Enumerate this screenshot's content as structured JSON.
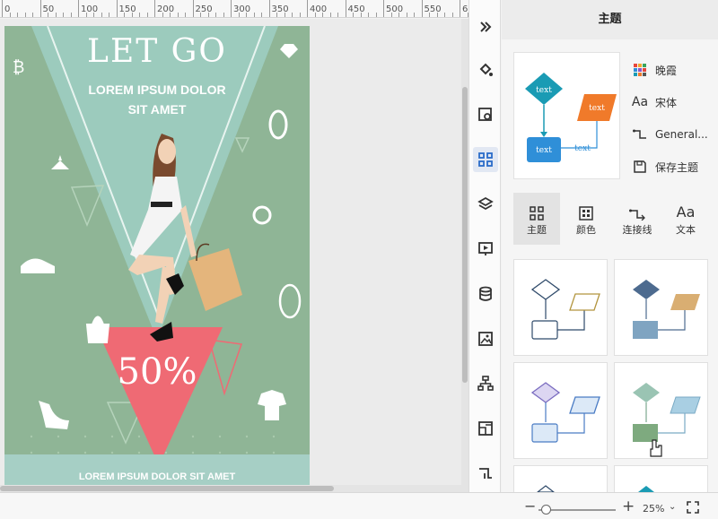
{
  "ruler": {
    "labels": [
      "0",
      "50",
      "100",
      "150",
      "200",
      "250",
      "300",
      "350",
      "400",
      "450",
      "500",
      "550",
      "6"
    ]
  },
  "poster": {
    "headline": "LET GO",
    "subline": "LOREM IPSUM DOLOR SIT AMET",
    "discount": "50%",
    "footer": "LOREM IPSUM DOLOR SIT AMET",
    "colors": {
      "background": "#8fb596",
      "triangle": "#9ccbbd",
      "sale_triangle": "#ef6a74",
      "bag": "#e4b57c"
    },
    "icons": [
      "currency-icon",
      "diamond-icon",
      "ring-icon",
      "lamp-icon",
      "shoe-icon",
      "handbag-icon",
      "gem-icon",
      "heel-icon",
      "tshirt-icon"
    ]
  },
  "iconbar": {
    "items": [
      {
        "name": "collapse-icon"
      },
      {
        "name": "fill-icon"
      },
      {
        "name": "image-edit-icon"
      },
      {
        "name": "theme-grid-icon",
        "active": true
      },
      {
        "name": "layers-icon"
      },
      {
        "name": "presentation-icon"
      },
      {
        "name": "database-icon"
      },
      {
        "name": "picture-icon"
      },
      {
        "name": "org-chart-icon"
      },
      {
        "name": "page-layout-icon"
      },
      {
        "name": "connector-icon"
      }
    ]
  },
  "panel": {
    "title": "主题",
    "preview": {
      "node_label": "text",
      "connector_label": "text",
      "colors": {
        "diamond": "#1a9bb4",
        "box": "#2f8fd8",
        "parallelogram": "#f07a2a"
      }
    },
    "props": [
      {
        "icon": "color-scheme-icon",
        "label": "晚霞"
      },
      {
        "icon": "font-icon",
        "label": "宋体",
        "icon_text": "Aa"
      },
      {
        "icon": "connector-style-icon",
        "label": "General..."
      },
      {
        "icon": "save-icon",
        "label": "保存主题"
      }
    ],
    "tabs": [
      {
        "label": "主题",
        "icon": "theme-grid-icon",
        "active": true
      },
      {
        "label": "颜色",
        "icon": "palette-icon"
      },
      {
        "label": "连接线",
        "icon": "connector-icon"
      },
      {
        "label": "文本",
        "icon": "text-icon",
        "icon_text": "Aa"
      }
    ],
    "themes": [
      {
        "fill_diamond": "#ffffff",
        "stroke": "#2f4a6a",
        "fill_box": "#ffffff",
        "fill_para": "#ffffff",
        "stroke_para": "#b2953e"
      },
      {
        "fill_diamond": "#4d6b8f",
        "stroke": "#4d6b8f",
        "fill_box": "#7fa4c1",
        "fill_para": "#d9ae72",
        "stroke_para": "#d9ae72"
      },
      {
        "fill_diamond": "#dcd6f2",
        "stroke": "#7a6cc0",
        "fill_box": "#dce9f7",
        "fill_para": "#dce9f7",
        "stroke_para": "#4a7cc4"
      },
      {
        "fill_diamond": "#9ac4b3",
        "stroke": "#7aa88f",
        "fill_box": "#7eaa7f",
        "fill_para": "#a9cfe3",
        "stroke_para": "#7aaac4"
      }
    ]
  },
  "zoom": {
    "minus": "−",
    "plus": "+",
    "value": "25%",
    "caret": "⌄",
    "level": 0.05
  }
}
